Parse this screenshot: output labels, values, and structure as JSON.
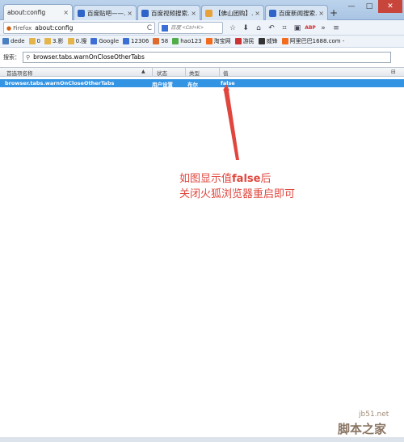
{
  "tabs": [
    {
      "label": "about:config",
      "icon_color": "#ffffff"
    },
    {
      "label": "百度贴吧——...",
      "icon_color": "#2f64c8"
    },
    {
      "label": "百度视频搜索...",
      "icon_color": "#2f64c8"
    },
    {
      "label": "【佛山团购】...",
      "icon_color": "#e8a23c"
    },
    {
      "label": "百度新闻搜索...",
      "icon_color": "#2f64c8"
    }
  ],
  "tab_close": "×",
  "new_tab": "+",
  "window_buttons": {
    "minimize": "—",
    "maximize": "□",
    "close": "✕"
  },
  "urlbar": {
    "browser": "Firefox",
    "url": "about:config",
    "reload": "C"
  },
  "searchbar": {
    "placeholder": "百度 <Ctrl+K>"
  },
  "nav_icons": [
    "☆",
    "⬇",
    "⌂",
    "↶",
    "⌗",
    "▣",
    "ABP",
    "»",
    "≡"
  ],
  "bookmarks": [
    {
      "label": "dede",
      "icon_color": "#4a7fc1"
    },
    {
      "label": "0",
      "icon_color": "#e4b54a"
    },
    {
      "label": "3.影",
      "icon_color": "#e4b54a"
    },
    {
      "label": "0.搜",
      "icon_color": "#e4b54a"
    },
    {
      "label": "Google",
      "icon_color": "#3b6fd6"
    },
    {
      "label": "12306",
      "icon_color": "#3b6fd6"
    },
    {
      "label": "58",
      "icon_color": "#e06a2b"
    },
    {
      "label": "hao123",
      "icon_color": "#4fae47"
    },
    {
      "label": "淘宝网",
      "icon_color": "#f36b1c"
    },
    {
      "label": "游民",
      "icon_color": "#c33"
    },
    {
      "label": "威锋",
      "icon_color": "#333"
    },
    {
      "label": "阿里巴巴1688.com -",
      "icon_color": "#f36b1c"
    }
  ],
  "config": {
    "search_label": "搜索：",
    "search_value": "browser.tabs.warnOnCloseOtherTabs",
    "columns": {
      "name": "首选项名称",
      "status": "状态",
      "type": "类型",
      "value": "值"
    },
    "row": {
      "name": "browser.tabs.warnOnCloseOtherTabs",
      "status": "用户设置",
      "type": "布尔",
      "value": "false"
    }
  },
  "annotation": {
    "line1_prefix": "如图显示值",
    "line1_bold": "false",
    "line1_suffix": "后",
    "line2": "关闭火狐浏览器重启即可",
    "color": "#e0463e"
  },
  "watermark": {
    "domain": "jb51.net",
    "name": "脚本之家"
  },
  "colors": {
    "selected_row": "#3394e4",
    "tab_strip": "#a9c4e3",
    "firefox": "#d36012"
  }
}
